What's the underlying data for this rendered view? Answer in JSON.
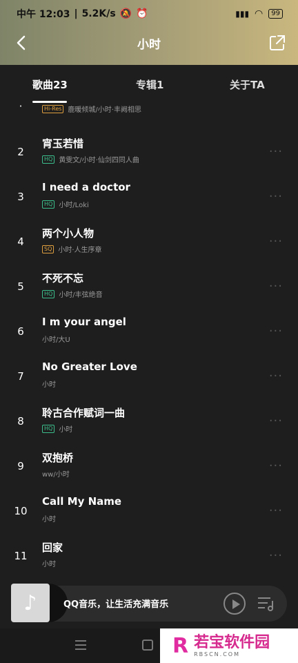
{
  "status": {
    "time": "中午 12:03",
    "speed": "5.2K/s",
    "battery": "99"
  },
  "header": {
    "title": "小时"
  },
  "tabs": [
    {
      "label": "歌曲23"
    },
    {
      "label": "专辑1"
    },
    {
      "label": "关于TA"
    }
  ],
  "songs": [
    {
      "num": "·",
      "title": "",
      "badge": "Hi-Res",
      "badge_color": "#e0a040",
      "sub": "鹿暖倾城/小时·丰阙相思"
    },
    {
      "num": "2",
      "title": "宵玉若惜",
      "badge": "HQ",
      "badge_color": "#3cbf8c",
      "sub": "黄雯文/小时·仙剑四同人曲"
    },
    {
      "num": "3",
      "title": "I need a doctor",
      "badge": "HQ",
      "badge_color": "#3cbf8c",
      "sub": "小时/Loki"
    },
    {
      "num": "4",
      "title": "两个小人物",
      "badge": "SQ",
      "badge_color": "#e0a040",
      "sub": "小时·人生序章"
    },
    {
      "num": "5",
      "title": "不死不忘",
      "badge": "HQ",
      "badge_color": "#3cbf8c",
      "sub": "小时/丰弦绝音"
    },
    {
      "num": "6",
      "title": "I m your angel",
      "badge": "",
      "badge_color": "",
      "sub": "小时/大U"
    },
    {
      "num": "7",
      "title": "No Greater Love",
      "badge": "",
      "badge_color": "",
      "sub": "小时"
    },
    {
      "num": "8",
      "title": "聆古合作赋词一曲",
      "badge": "HQ",
      "badge_color": "#3cbf8c",
      "sub": "小时"
    },
    {
      "num": "9",
      "title": "双抱桥",
      "badge": "",
      "badge_color": "",
      "sub": "ww/小时"
    },
    {
      "num": "10",
      "title": "Call My Name",
      "badge": "",
      "badge_color": "",
      "sub": "小时"
    },
    {
      "num": "11",
      "title": "回家",
      "badge": "",
      "badge_color": "",
      "sub": "小时"
    }
  ],
  "player": {
    "text": "QQ音乐，让生活充满音乐"
  },
  "watermark": {
    "name": "若宝软件园",
    "url": "RBSCN.COM"
  }
}
